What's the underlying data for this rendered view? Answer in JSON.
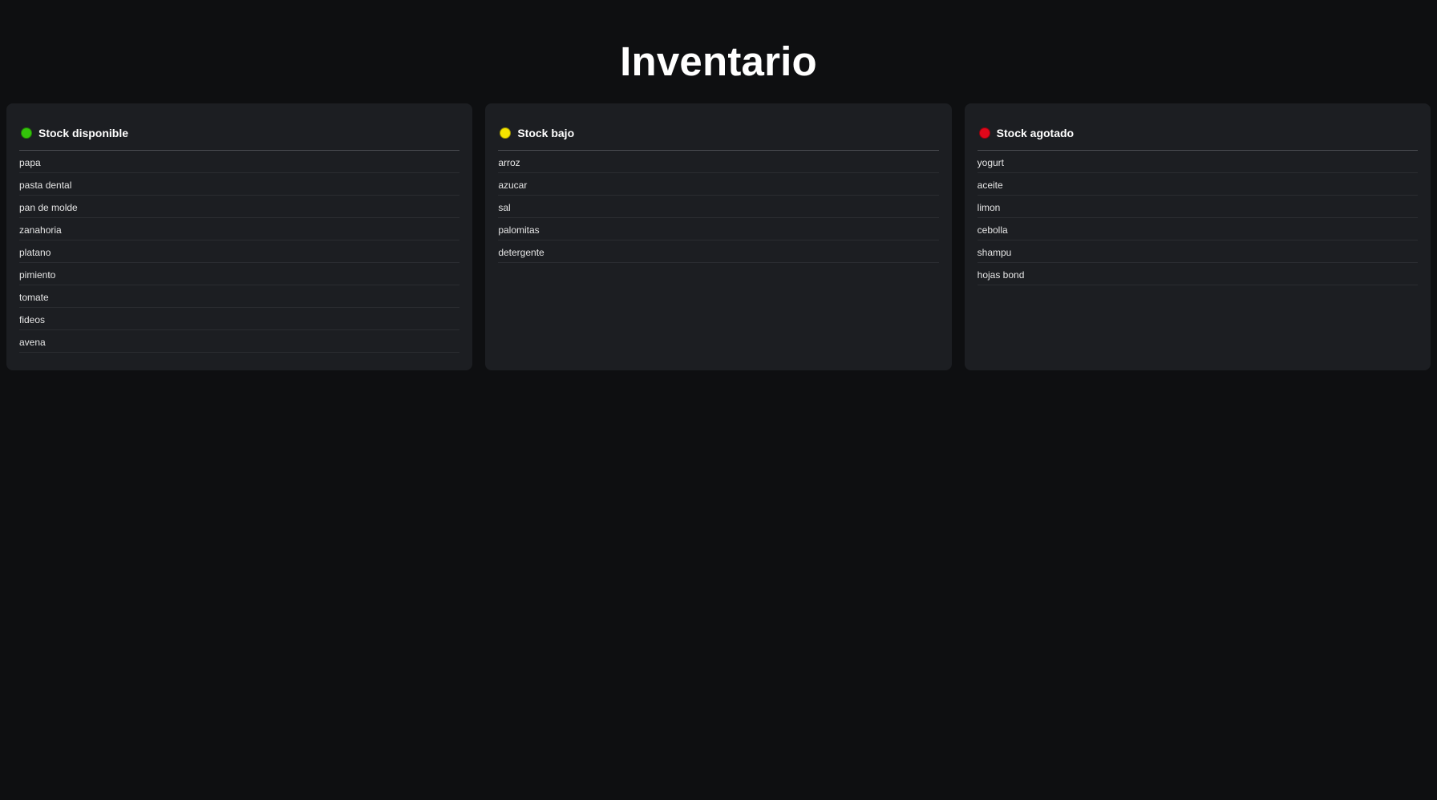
{
  "page": {
    "title": "Inventario"
  },
  "columns": [
    {
      "title": "Stock disponible",
      "status_color": "#33c40a",
      "status_icon": "green-status-dot-icon",
      "items": [
        "papa",
        "pasta dental",
        "pan de molde",
        "zanahoria",
        "platano",
        "pimiento",
        "tomate",
        "fideos",
        "avena"
      ]
    },
    {
      "title": "Stock bajo",
      "status_color": "#f5e400",
      "status_icon": "yellow-status-dot-icon",
      "items": [
        "arroz",
        "azucar",
        "sal",
        "palomitas",
        "detergente"
      ]
    },
    {
      "title": "Stock agotado",
      "status_color": "#e0071a",
      "status_icon": "red-status-dot-icon",
      "items": [
        "yogurt",
        "aceite",
        "limon",
        "cebolla",
        "shampu",
        "hojas bond"
      ]
    }
  ]
}
